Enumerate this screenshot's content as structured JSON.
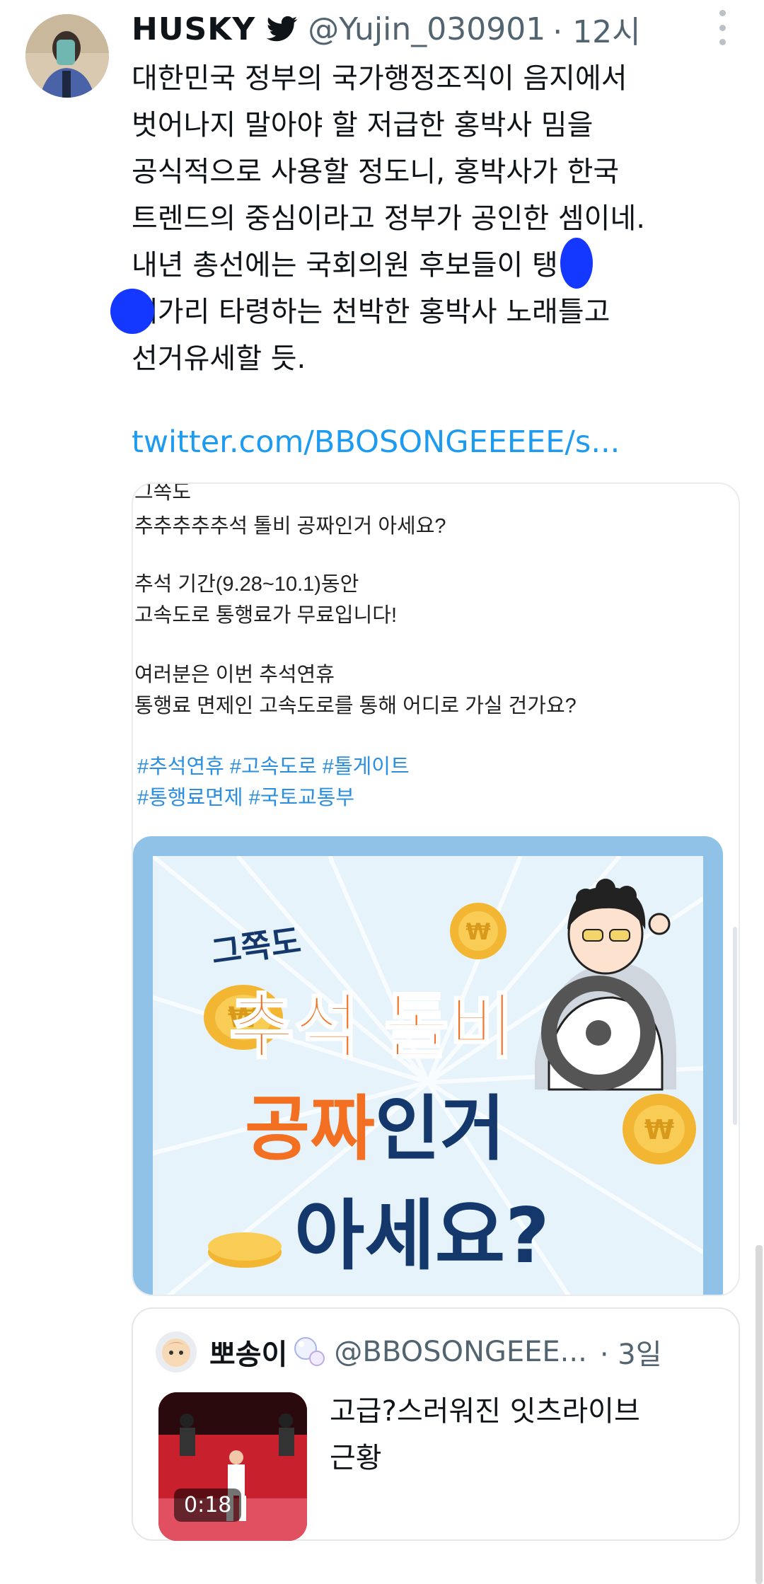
{
  "tweet": {
    "display_name": "HUSKY",
    "handle": "@Yujin_030901",
    "time": "· 12시",
    "text_lines": [
      "대한민국 정부의 국가행정조직이 음지에서",
      "벗어나지 말아야 할 저급한 홍박사 밈을",
      "공식적으로 사용할 정도니, 홍박사가 한국",
      "트렌드의 중심이라고 정부가 공인한 셈이네.",
      "내년 총선에는 국회의원 후보들이  탱이",
      "  대가리 타령하는 천박한 홍박사 노래틀고",
      "선거유세할 듯."
    ],
    "link": "twitter.com/BBOSONGEEEEE/s..."
  },
  "card": {
    "text_lines": [
      "그쪽도",
      "추추추추추석 톨비 공짜인거 아세요?",
      "추석 기간(9.28~10.1)동안",
      "고속도로 통행료가 무료입니다!",
      "여러분은 이번 추석연휴",
      "통행료 면제인 고속도로를 통해  어디로 가실 건가요?"
    ],
    "hashtags": [
      "#추석연휴 #고속도로 #톨게이트",
      "#통행료면제 #국토교통부"
    ],
    "promo": {
      "small_title": "그쪽도",
      "line1": "추석 톨비",
      "line2_a": "공짜",
      "line2_b": "인거",
      "line3": "아세요?",
      "accent_orange": "#f36f21",
      "accent_navy": "#14386b"
    }
  },
  "quote": {
    "display_name": "뽀송이",
    "handle": "@BBOSONGEEE...",
    "time": "· 3일",
    "text_lines": [
      "고급?스러워진 잇츠라이브",
      "근황"
    ],
    "video_duration": "0:18"
  },
  "icons": [
    "twitter-bird-icon",
    "more-options-icon",
    "bubble-icon"
  ],
  "colors": {
    "link": "#1d9bf0",
    "bird": "#0f1419",
    "redaction": "#1438ff"
  }
}
